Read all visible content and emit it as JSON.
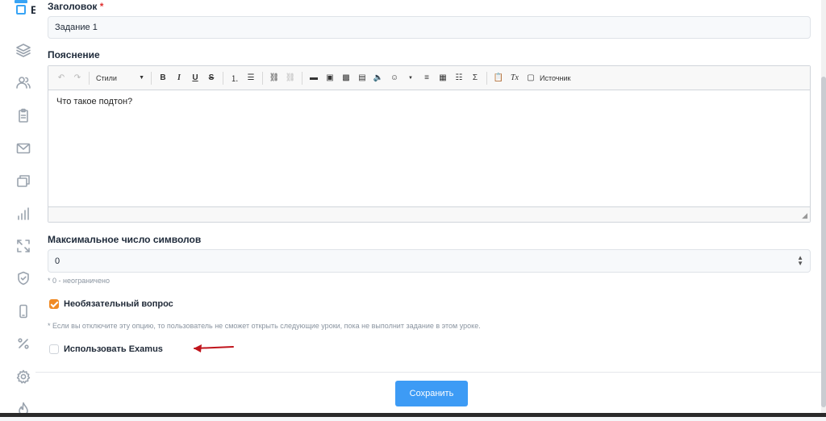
{
  "logo": {
    "letter": "B",
    "color": "#38a4f5"
  },
  "sidebar": {
    "icons": [
      "layers-icon",
      "users-icon",
      "clipboard-icon",
      "mail-icon",
      "windows-icon",
      "bar-chart-icon",
      "expand-icon",
      "shield-check-icon",
      "phone-icon",
      "percent-icon",
      "settings-icon",
      "fire-icon"
    ]
  },
  "form": {
    "title": {
      "label": "Заголовок",
      "required_mark": "*",
      "value": "Задание 1"
    },
    "explanation": {
      "label": "Пояснение",
      "toolbar": {
        "styles_label": "Стили",
        "source_label": "Источник"
      },
      "content": "Что такое подтон?"
    },
    "max_chars": {
      "label": "Максимальное число символов",
      "value": "0",
      "hint": "* 0 - неограничено"
    },
    "optional": {
      "label": "Необязательный вопрос",
      "checked": true,
      "hint": "* Если вы отключите эту опцию, то пользователь не сможет открыть следующие уроки, пока не выполнит задание в этом уроке."
    },
    "examus": {
      "label": "Использовать Examus",
      "checked": false
    }
  },
  "actions": {
    "save_label": "Сохранить"
  },
  "colors": {
    "accent": "#3d9bf5",
    "checkbox_on": "#f08a24",
    "annotation_arrow": "#c0141c"
  }
}
